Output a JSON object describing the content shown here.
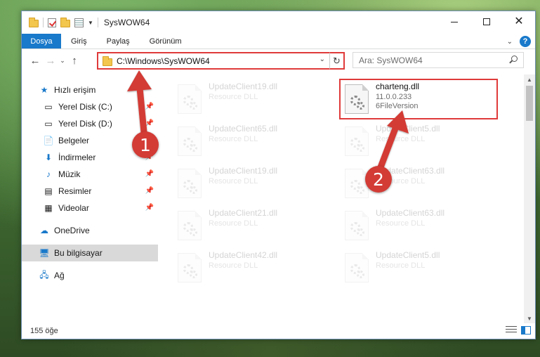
{
  "window": {
    "title": "SysWOW64"
  },
  "ribbon": {
    "tabs": [
      "Dosya",
      "Giriş",
      "Paylaş",
      "Görünüm"
    ]
  },
  "address": {
    "path": "C:\\Windows\\SysWOW64"
  },
  "search": {
    "placeholder": "Ara: SysWOW64"
  },
  "navpane": {
    "quick_access": "Hızlı erişim",
    "items": [
      {
        "label": "Yerel Disk (C:)",
        "icon": "drive-icon",
        "pinned": true
      },
      {
        "label": "Yerel Disk (D:)",
        "icon": "drive-icon",
        "pinned": true
      },
      {
        "label": "Belgeler",
        "icon": "documents-icon",
        "pinned": true
      },
      {
        "label": "İndirmeler",
        "icon": "downloads-icon",
        "pinned": true
      },
      {
        "label": "Müzik",
        "icon": "music-icon",
        "pinned": true
      },
      {
        "label": "Resimler",
        "icon": "pictures-icon",
        "pinned": true
      },
      {
        "label": "Videolar",
        "icon": "videos-icon",
        "pinned": true
      }
    ],
    "onedrive": "OneDrive",
    "this_pc": "Bu bilgisayar",
    "network": "Ağ"
  },
  "files": {
    "left": [
      {
        "name": "UpdateClient19.dll",
        "desc": "Resource DLL"
      },
      {
        "name": "UpdateClient65.dll",
        "desc": "Resource DLL"
      },
      {
        "name": "UpdateClient19.dll",
        "desc": "Resource DLL"
      },
      {
        "name": "UpdateClient21.dll",
        "desc": "Resource DLL"
      },
      {
        "name": "UpdateClient42.dll",
        "desc": "Resource DLL"
      }
    ],
    "right": [
      {
        "name": "charteng.dll",
        "version": "11.0.0.233",
        "desc": "6FileVersion"
      },
      {
        "name": "UpdateClient5.dll",
        "desc": "Resource DLL"
      },
      {
        "name": "UpdateClient63.dll",
        "desc": "Resource DLL"
      },
      {
        "name": "UpdateClient63.dll",
        "desc": "Resource DLL"
      },
      {
        "name": "UpdateClient5.dll",
        "desc": "Resource DLL"
      }
    ]
  },
  "status": {
    "count": "155 öğe"
  },
  "callouts": [
    "1",
    "2"
  ],
  "colors": {
    "accent": "#1979ca",
    "highlight": "#e03a3a",
    "callout": "#d33b35"
  }
}
